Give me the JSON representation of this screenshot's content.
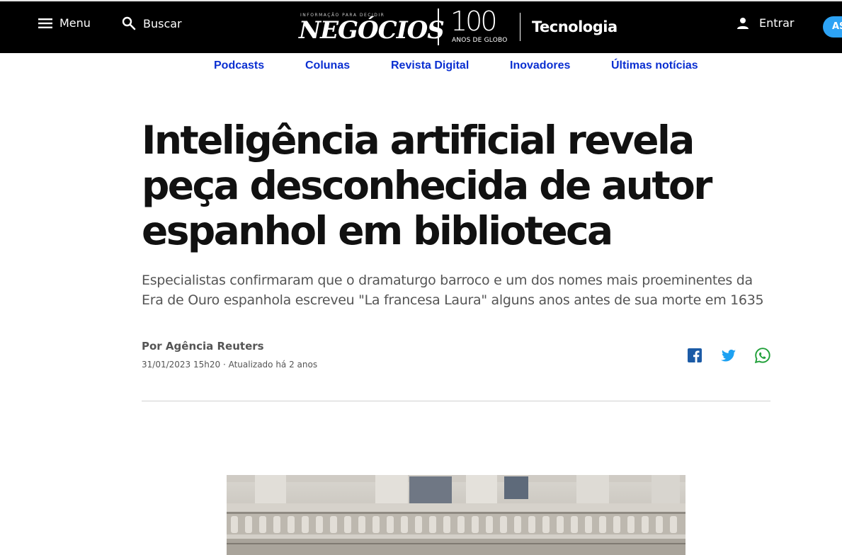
{
  "header": {
    "menu_label": "Menu",
    "search_label": "Buscar",
    "login_label": "Entrar",
    "subscribe_label": "AS",
    "brand": {
      "tagline": "INFORMAÇÃO PARA DECIDIR",
      "wordmark": "NEGÓCIOS",
      "anniversary_number": "100",
      "anniversary_text": "ANOS DE GLOBO",
      "section": "Tecnologia"
    }
  },
  "section_nav": {
    "items": [
      {
        "label": "Podcasts"
      },
      {
        "label": "Colunas"
      },
      {
        "label": "Revista Digital"
      },
      {
        "label": "Inovadores"
      },
      {
        "label": "Últimas notícias"
      }
    ]
  },
  "article": {
    "title": "Inteligência artificial revela peça desconhecida de autor espanhol em biblioteca",
    "subtitle": "Especialistas confirmaram que o dramaturgo barroco e um dos nomes mais proeminentes da Era de Ouro espanhola escreveu \"La francesa Laura\" alguns anos antes de sua morte em 1635",
    "byline": "Por Agência Reuters",
    "dateline": "31/01/2023 15h20 · Atualizado há 2 anos"
  },
  "share": {
    "icons": [
      "facebook-icon",
      "twitter-icon",
      "whatsapp-icon"
    ]
  },
  "colors": {
    "topbar_bg": "#000000",
    "nav_link": "#0a2fd1",
    "subscribe": "#2da3f5",
    "facebook": "#1c5ba6",
    "twitter": "#1da1f2",
    "whatsapp": "#1f9f38"
  }
}
